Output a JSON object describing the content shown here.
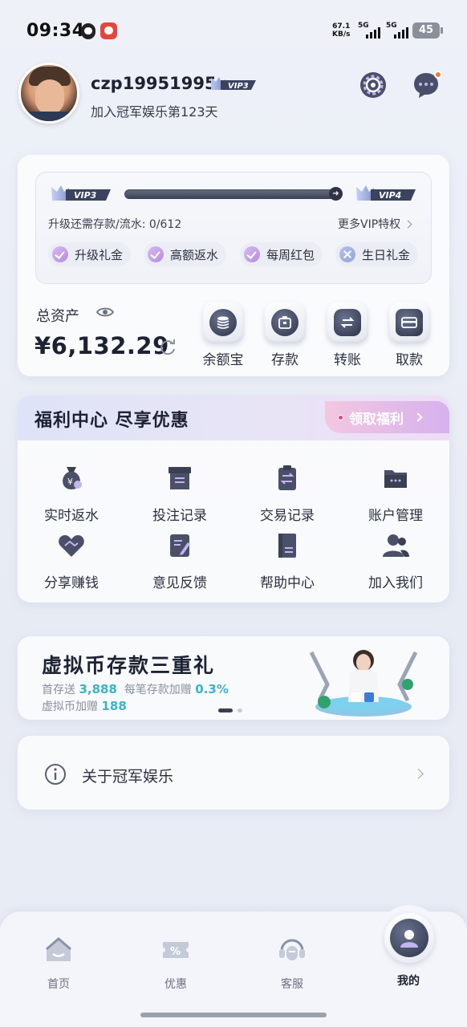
{
  "status_bar": {
    "time": "09:34",
    "net_speed_value": "67.1",
    "net_speed_unit": "KB/s",
    "signal1_label": "5G",
    "signal2_label": "5G",
    "battery": "45"
  },
  "profile": {
    "username": "czp19951995",
    "vip_badge": "VIP3",
    "join_text": "加入冠军娱乐第123天",
    "settings_icon": "gear-icon",
    "message_icon": "chat-bubble-icon"
  },
  "vip": {
    "current_level": "VIP3",
    "next_level": "VIP4",
    "progress": 0.0,
    "upgrade_text": "升级还需存款/流水: 0/612",
    "more_link": "更多VIP特权",
    "perks": [
      {
        "label": "升级礼金",
        "status": "checked"
      },
      {
        "label": "高额返水",
        "status": "checked"
      },
      {
        "label": "每周红包",
        "status": "checked"
      },
      {
        "label": "生日礼金",
        "status": "unavailable"
      }
    ]
  },
  "assets": {
    "label": "总资产",
    "value": "¥6,132.29",
    "actions": [
      {
        "label": "余额宝",
        "icon": "coin-stack-icon"
      },
      {
        "label": "存款",
        "icon": "wallet-icon"
      },
      {
        "label": "转账",
        "icon": "transfer-icon"
      },
      {
        "label": "取款",
        "icon": "card-icon"
      }
    ]
  },
  "welfare": {
    "title": "福利中心  尽享优惠",
    "claim_label": "领取福利",
    "items": [
      {
        "label": "实时返水",
        "icon": "money-bag-icon"
      },
      {
        "label": "投注记录",
        "icon": "archive-box-icon"
      },
      {
        "label": "交易记录",
        "icon": "clipboard-transfer-icon"
      },
      {
        "label": "账户管理",
        "icon": "folder-icon"
      },
      {
        "label": "分享赚钱",
        "icon": "handshake-heart-icon"
      },
      {
        "label": "意见反馈",
        "icon": "feedback-note-icon"
      },
      {
        "label": "帮助中心",
        "icon": "help-book-icon"
      },
      {
        "label": "加入我们",
        "icon": "users-icon"
      }
    ]
  },
  "banner": {
    "title": "虚拟币存款三重礼",
    "line1_prefix": "首存送",
    "line1_value1": "3,888",
    "line1_mid": "每笔存款加赠",
    "line1_value2": "0.3%",
    "line2_prefix": "虚拟币加赠",
    "line2_value": "188",
    "slide_count": 2,
    "active_slide": 1
  },
  "about": {
    "label": "关于冠军娱乐"
  },
  "tabbar": {
    "tabs": [
      {
        "label": "首页",
        "icon": "home-icon"
      },
      {
        "label": "优惠",
        "icon": "coupon-icon"
      },
      {
        "label": "客服",
        "icon": "headset-icon"
      },
      {
        "label": "我的",
        "icon": "user-icon"
      }
    ],
    "active": "我的"
  },
  "colors": {
    "accent_dark": "#2d3346",
    "accent_teal": "#38b3c9",
    "claim_gradient_start": "#f3c7e0",
    "claim_gradient_end": "#d6b1ee",
    "dot_red": "#e8408a",
    "notify_orange": "#f07a3a"
  }
}
